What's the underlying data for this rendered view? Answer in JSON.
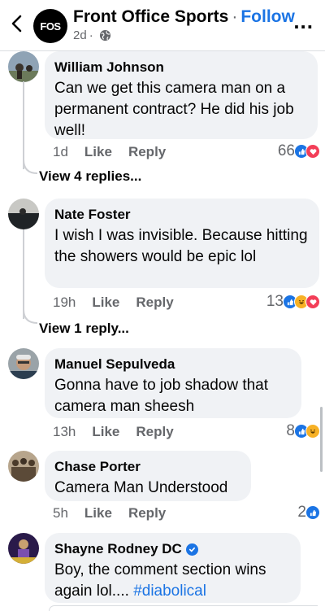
{
  "header": {
    "page_name": "Front Office Sports",
    "separator": "·",
    "follow_label": "Follow",
    "post_age": "2d",
    "logo_text": "FOS",
    "more_label": "..."
  },
  "comments": [
    {
      "author": "William Johnson",
      "text": "Can we get this camera man on a permanent contract?  He did his job well!",
      "time": "1d",
      "like_label": "Like",
      "reply_label": "Reply",
      "reaction_count": "66",
      "reactions": [
        "like-reaction-icon",
        "love-reaction-icon"
      ]
    },
    {
      "author": "Nate Foster",
      "text": "I wish I was invisible. Because hitting the showers would be epic lol",
      "time": "19h",
      "like_label": "Like",
      "reply_label": "Reply",
      "reaction_count": "13",
      "reactions": [
        "like-reaction-icon",
        "haha-reaction-icon",
        "love-reaction-icon"
      ]
    },
    {
      "author": "Manuel Sepulveda",
      "text": "Gonna have to job shadow that camera man sheesh",
      "time": "13h",
      "like_label": "Like",
      "reply_label": "Reply",
      "reaction_count": "8",
      "reactions": [
        "like-reaction-icon",
        "haha-reaction-icon"
      ]
    },
    {
      "author": "Chase Porter",
      "text": "Camera Man Understood",
      "time": "5h",
      "like_label": "Like",
      "reply_label": "Reply",
      "reaction_count": "2",
      "reactions": [
        "like-reaction-icon"
      ]
    },
    {
      "author": "Shayne Rodney DC",
      "text_before": "Boy, the comment section wins again lol....",
      "hashtag": "#diabolical",
      "verified": true
    }
  ],
  "view_replies": [
    "View 4 replies...",
    "View 1 reply..."
  ],
  "colors": {
    "accent": "#1b74e4",
    "bubble": "#f0f2f5",
    "muted": "#65676b",
    "haha": "#f7b125",
    "love": "#f33e58"
  }
}
